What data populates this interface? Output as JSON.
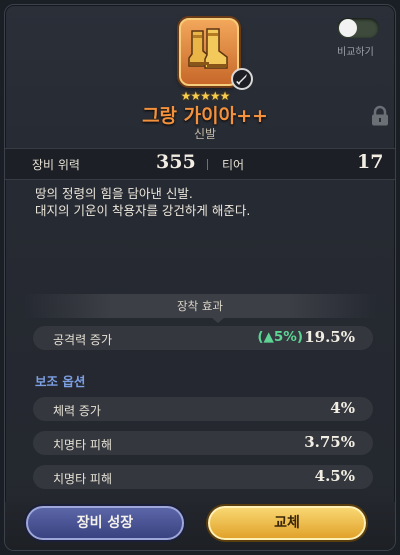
{
  "item": {
    "stars": "★★★★★",
    "name": "그랑 가이아++",
    "type": "신발",
    "icon": "golden-boots-icon",
    "badge_icon": "sword-icon"
  },
  "compare": {
    "label": "비교하기",
    "enabled": false
  },
  "lock_icon": "lock-icon",
  "stats": {
    "power_label": "장비 위력",
    "power_value": "355",
    "tier_label": "티어",
    "tier_value": "17"
  },
  "description": {
    "line1": "땅의 정령의 힘을 담아낸 신발.",
    "line2": "대지의 기운이 착용자를 강건하게 해준다."
  },
  "equip_effect": {
    "title": "장착 효과",
    "main": {
      "label": "공격력 증가",
      "bonus": "(▲5%)",
      "value": "19.5%"
    }
  },
  "sub_options": {
    "title": "보조 옵션",
    "items": [
      {
        "label": "체력 증가",
        "value": "4%"
      },
      {
        "label": "치명타 피해",
        "value": "3.75%"
      },
      {
        "label": "치명타 피해",
        "value": "4.5%"
      }
    ]
  },
  "buttons": {
    "grow": "장비 성장",
    "swap": "교체"
  },
  "colors": {
    "item_name": "#f3913c",
    "bonus_green": "#5dd394",
    "sub_title_blue": "#7c9fe2",
    "star_gold": "#f5cc4e"
  }
}
